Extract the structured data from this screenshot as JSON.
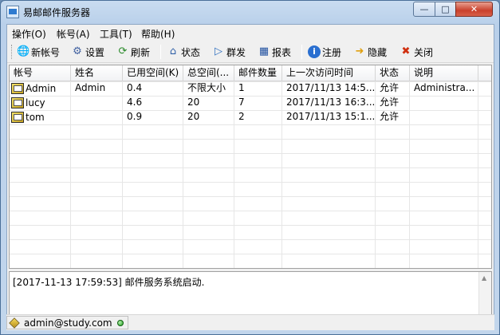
{
  "window": {
    "title": "易邮邮件服务器",
    "min_label": "—",
    "max_label": "□",
    "close_label": "✕"
  },
  "menu": [
    {
      "label": "操作(O)"
    },
    {
      "label": "帐号(A)"
    },
    {
      "label": "工具(T)"
    },
    {
      "label": "帮助(H)"
    }
  ],
  "toolbar": {
    "new_account": "新帐号",
    "settings": "设置",
    "refresh": "刷新",
    "status": "状态",
    "broadcast": "群发",
    "report": "报表",
    "register": "注册",
    "hide": "隐藏",
    "close": "关闭"
  },
  "table": {
    "columns": [
      "帐号",
      "姓名",
      "已用空间(K)",
      "总空间(...",
      "邮件数量",
      "上一次访问时间",
      "状态",
      "说明"
    ],
    "rows": [
      [
        "Admin",
        "Admin",
        "0.4",
        "不限大小",
        "1",
        "2017/11/13 14:5...",
        "允许",
        "Administra..."
      ],
      [
        "lucy",
        "",
        "4.6",
        "20",
        "7",
        "2017/11/13 16:3...",
        "允许",
        ""
      ],
      [
        "tom",
        "",
        "0.9",
        "20",
        "2",
        "2017/11/13 15:1...",
        "允许",
        ""
      ]
    ]
  },
  "log": {
    "lines": [
      "[2017-11-13 17:59:53] 邮件服务系统启动."
    ]
  },
  "statusbar": {
    "user": "admin@study.com"
  }
}
